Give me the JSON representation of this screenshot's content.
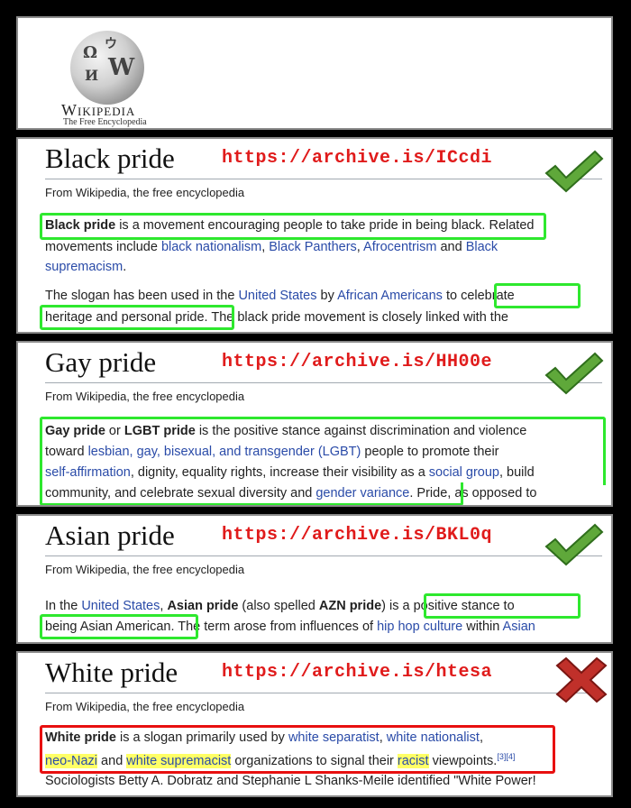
{
  "logo": {
    "name": "Wikipedia",
    "tagline": "The Free Encyclopedia",
    "glyphs": [
      "Ω",
      "W",
      "И",
      "ウ"
    ]
  },
  "from_text": "From Wikipedia, the free encyclopedia",
  "icons": {
    "check": "check-icon",
    "cross": "cross-icon"
  },
  "colors": {
    "url": "#e01b1b",
    "good_box": "#2ee82e",
    "bad_box": "#e81010",
    "link": "#2a4ba8",
    "highlight": "#ffff66"
  },
  "panels": {
    "black": {
      "title": "Black pride",
      "url": "https://archive.is/ICcdi",
      "l1": {
        "b": "Black pride",
        "t1": " is a movement encouraging people to take pride in being black. ",
        "t2": "Related"
      },
      "l2": {
        "t1": "movements include ",
        "a1": "black nationalism",
        "s1": ", ",
        "a2": "Black Panthers",
        "s2": ", ",
        "a3": "Afrocentrism",
        "s3": " and ",
        "a4": "Black"
      },
      "l3": {
        "a1": "supremacism",
        "s1": "."
      },
      "l4": {
        "t1": "The slogan has been used in the ",
        "a1": "United States",
        "t2": " by ",
        "a2": "African Americans",
        "t3": " to celebrate"
      },
      "l5": {
        "t1": "heritage and personal pride.",
        "t2": " The black pride movement is closely linked with the"
      }
    },
    "gay": {
      "title": "Gay pride",
      "url": "https://archive.is/HH00e",
      "l1": {
        "b1": "Gay pride",
        "t1": " or ",
        "b2": "LGBT pride",
        "t2": " is the positive stance against discrimination and violence"
      },
      "l2": {
        "t1": "toward ",
        "a1": "lesbian, gay, bisexual, and transgender (LGBT)",
        "t2": " people to promote their"
      },
      "l3": {
        "a1": "self-affirmation",
        "t1": ", dignity, equality rights, increase their visibility as a ",
        "a2": "social group",
        "t2": ", build"
      },
      "l4": {
        "t1": "community, and celebrate sexual diversity and ",
        "a1": "gender variance",
        "t2": ". ",
        "t3": "Pride, as opposed to"
      }
    },
    "asian": {
      "title": "Asian pride",
      "url": "https://archive.is/BKL0q",
      "l1": {
        "t1": "In the ",
        "a1": "United States",
        "t2": ", ",
        "b1": "Asian pride",
        "t3": " (also spelled ",
        "b2": "AZN pride",
        "t4": ") is a positive stance to"
      },
      "l2": {
        "t1": "being Asian American.",
        "t2": " The term arose from influences of ",
        "a1": "hip hop culture",
        "t3": " within ",
        "a2": "Asian"
      }
    },
    "white": {
      "title": "White pride",
      "url": "https://archive.is/htesa",
      "l1": {
        "b1": "White pride",
        "t1": " is a slogan primarily used by ",
        "a1": "white separatist",
        "s1": ", ",
        "a2": "white nationalist",
        "s2": ","
      },
      "l2": {
        "a1": "neo-Nazi",
        "t1": " and ",
        "a2": "white supremacist",
        "t2": " organizations to signal their ",
        "a3": "racist",
        "t3": " viewpoints.",
        "sup": "[3][4]"
      },
      "l3": {
        "t1": "Sociologists Betty A. Dobratz and Stephanie L Shanks-Meile identified \"White Power!"
      }
    }
  }
}
